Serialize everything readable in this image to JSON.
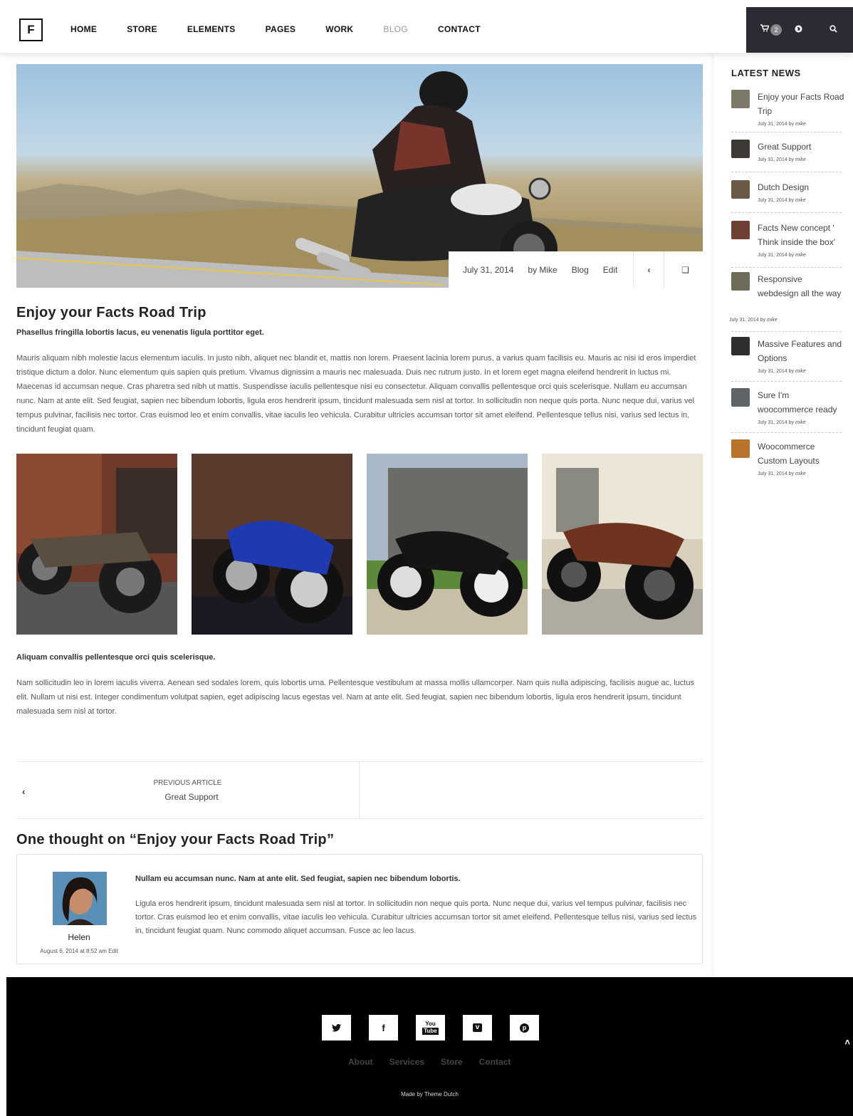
{
  "header": {
    "logo": "F",
    "nav": [
      "HOME",
      "STORE",
      "ELEMENTS",
      "PAGES",
      "WORK",
      "BLOG",
      "CONTACT"
    ],
    "cart_count": "2"
  },
  "post": {
    "meta": {
      "date": "July 31, 2014",
      "author": "by Mike",
      "category": "Blog",
      "edit": "Edit"
    },
    "title": "Enjoy your Facts Road Trip",
    "lead": "Phasellus fringilla lobortis lacus, eu venenatis ligula porttitor eget.",
    "body1": "Mauris aliquam nibh molestie lacus elementum iaculis. In justo nibh, aliquet nec blandit et, mattis non lorem. Praesent lacinia lorem purus, a varius quam facilisis eu. Mauris ac nisi id eros imperdiet tristique dictum a dolor. Nunc elementum quis sapien quis pretium. Vivamus dignissim a mauris nec malesuada. Duis nec rutrum justo. In et lorem eget magna eleifend hendrerit in luctus mi. Maecenas id accumsan neque. Cras pharetra sed nibh ut mattis. Suspendisse iaculis pellentesque nisi eu consectetur. Aliquam convallis pellentesque orci quis scelerisque. Nullam eu accumsan nunc. Nam at ante elit. Sed feugiat, sapien nec bibendum lobortis, ligula eros hendrerit ipsum, tincidunt malesuada sem nisl at tortor. In sollicitudin non neque quis porta. Nunc neque dui, varius vel tempus pulvinar, facilisis nec tortor. Cras euismod leo et enim convallis, vitae iaculis leo vehicula. Curabitur ultricies accumsan tortor sit amet eleifend. Pellentesque tellus nisi, varius sed lectus in, tincidunt feugiat quam.",
    "lead2": "Aliquam convallis pellentesque orci quis scelerisque.",
    "body2": "Nam sollicitudin leo in lorem iaculis viverra. Aenean sed sodales lorem, quis lobortis urna. Pellentesque vestibulum at massa mollis ullamcorper. Nam quis nulla adipiscing, facilisis augue ac, luctus elit. Nullam ut nisi est. Integer condimentum volutpat sapien, eget adipiscing lacus egestas vel. Nam at ante elit. Sed feugiat, sapien nec bibendum lobortis, ligula eros hendrerit ipsum, tincidunt malesuada sem nisl at tortor."
  },
  "post_nav": {
    "label": "PREVIOUS ARTICLE",
    "title": "Great Support"
  },
  "comments": {
    "title": "One thought on “Enjoy your Facts Road Trip”",
    "items": [
      {
        "author": "Helen",
        "date": "August 6, 2014 at 8:52 am Edit",
        "lead": "Nullam eu accumsan nunc. Nam at ante elit. Sed feugiat, sapien nec bibendum lobortis.",
        "text": "Ligula eros hendrerit ipsum, tincidunt malesuada sem nisl at tortor. In sollicitudin non neque quis porta. Nunc neque dui, varius vel tempus pulvinar, facilisis nec tortor. Cras euismod leo et enim convallis, vitae iaculis leo vehicula. Curabitur ultricies accumsan tortor sit amet eleifend. Pellentesque tellus nisi, varius sed lectus in, tincidunt feugiat quam. Nunc commodo aliquet accumsan. Fusce ac leo lacus."
      }
    ]
  },
  "sidebar": {
    "title": "LATEST NEWS",
    "items": [
      {
        "title": "Enjoy your Facts Road Trip",
        "date": "July 31, 2014 by",
        "author": "mike"
      },
      {
        "title": "Great Support",
        "date": "July 31, 2014 by",
        "author": "mike"
      },
      {
        "title": "Dutch Design",
        "date": "July 31, 2014 by",
        "author": "mike"
      },
      {
        "title": "Facts New concept ' Think inside the box'",
        "date": "July 31, 2014 by",
        "author": "mike"
      },
      {
        "title": "Responsive webdesign all the way",
        "date": "July 31, 2014 by",
        "author": "mike"
      },
      {
        "title": "Massive Features and Options",
        "date": "July 31, 2014 by",
        "author": "mike"
      },
      {
        "title": "Sure I'm woocommerce ready",
        "date": "July 31, 2014 by",
        "author": "mike"
      },
      {
        "title": "Woocommerce Custom Layouts",
        "date": "July 31, 2014 by",
        "author": "mike"
      }
    ]
  },
  "footer": {
    "social": [
      "twitter-icon",
      "facebook-icon",
      "youtube-icon",
      "vimeo-icon",
      "pinterest-icon"
    ],
    "links": [
      "About",
      "Services",
      "Store",
      "Contact"
    ],
    "made_by": "Made by Theme Dutch"
  }
}
